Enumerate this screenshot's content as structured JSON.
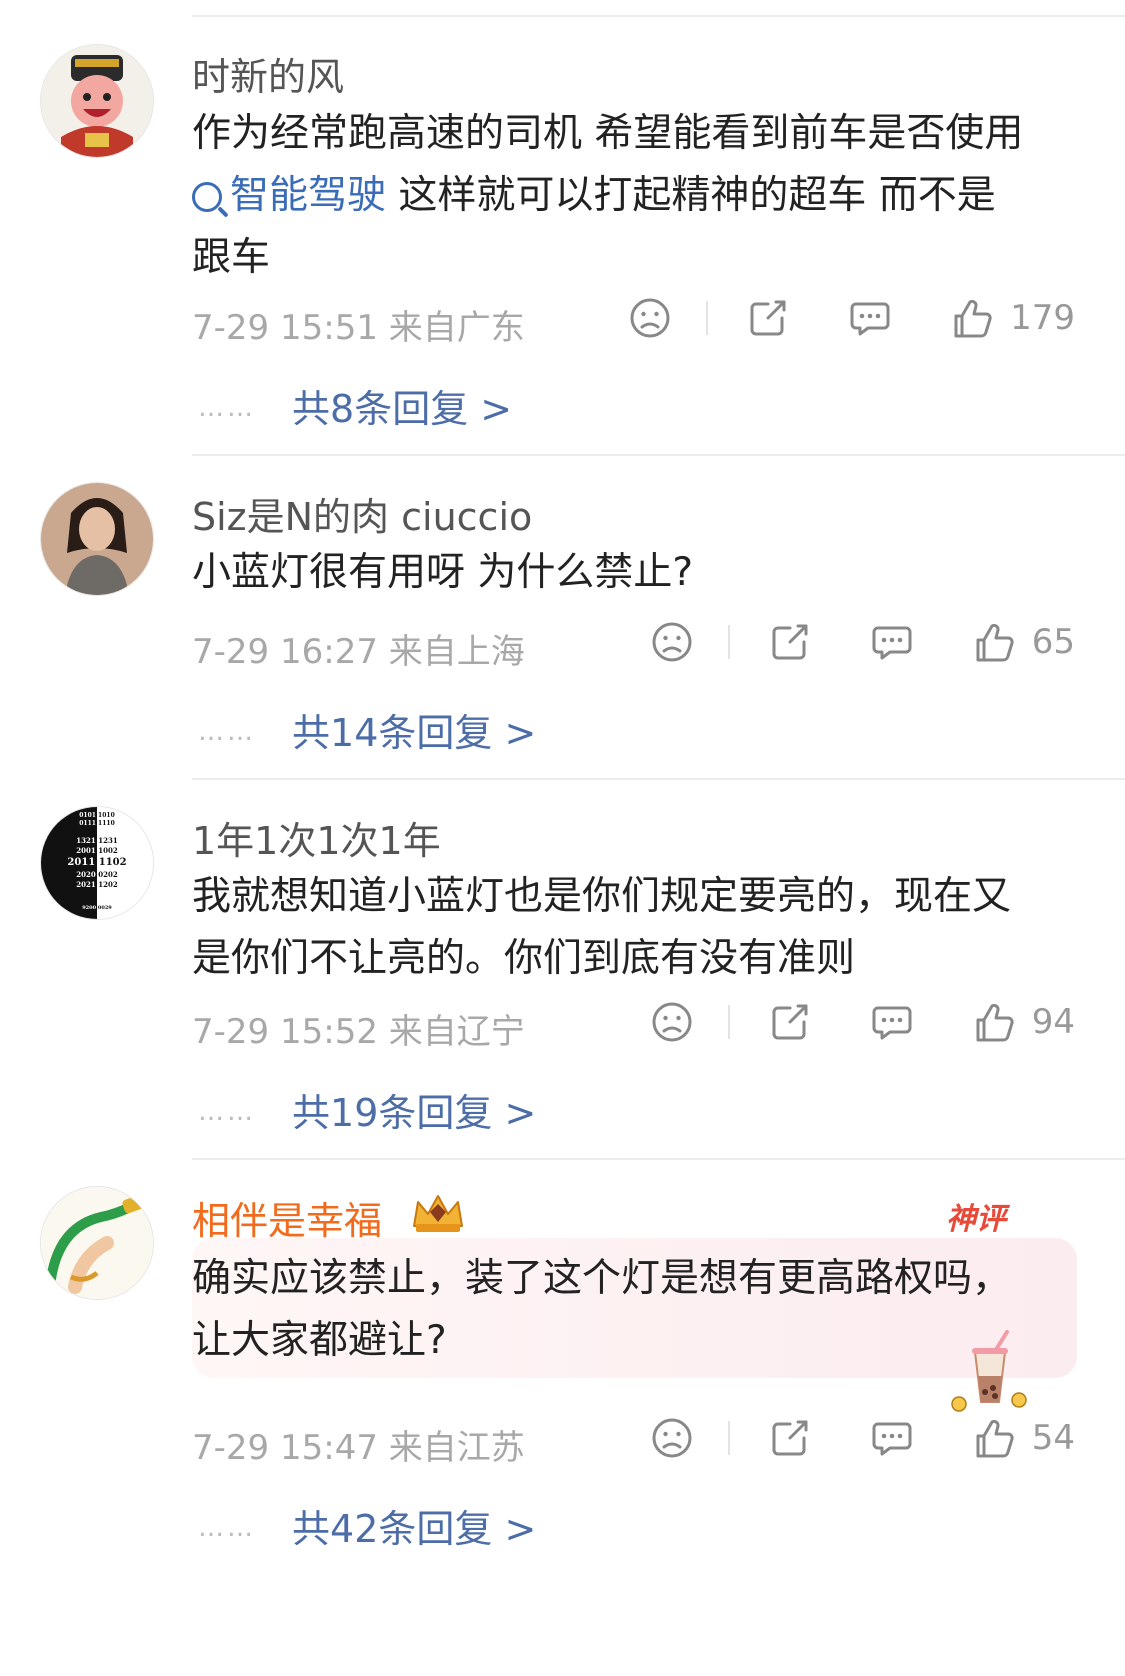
{
  "comments": [
    {
      "username": "时新的风",
      "body_line1": "作为经常跑高速的司机 希望能看到前车是否使用",
      "topic": "智能驾驶",
      "body_line2_rest": " 这样就可以打起精神的超车 而不是",
      "body_line3": "跟车",
      "time": "7-29 15:51",
      "location": "来自广东",
      "likes": "179",
      "replies_prefix": "共",
      "replies_count": "8",
      "replies_suffix": "条回复 >"
    },
    {
      "username": "Siz是N的肉 ciuccio",
      "body": "小蓝灯很有用呀 为什么禁止?",
      "time": "7-29 16:27",
      "location": "来自上海",
      "likes": "65",
      "replies_prefix": "共",
      "replies_count": "14",
      "replies_suffix": "条回复 >"
    },
    {
      "username": "1年1次1次1年",
      "body_line1": "我就想知道小蓝灯也是你们规定要亮的，现在又",
      "body_line2": "是你们不让亮的。你们到底有没有准则",
      "time": "7-29 15:52",
      "location": "来自辽宁",
      "likes": "94",
      "replies_prefix": "共",
      "replies_count": "19",
      "replies_suffix": "条回复 >"
    },
    {
      "username": "相伴是幸福",
      "badge": "神评",
      "body_line1": "确实应该禁止，装了这个灯是想有更高路权吗，",
      "body_line2": "让大家都避让?",
      "time": "7-29 15:47",
      "location": "来自江苏",
      "likes": "54",
      "replies_prefix": "共",
      "replies_count": "42",
      "replies_suffix": "条回复 >"
    }
  ],
  "dots": "……",
  "avatar3_lines": [
    "0101 1010",
    "0111 1110",
    "1321 1231",
    "2001 1002",
    "2011 1102",
    "2020 0202",
    "2021 1202",
    "9200 0029"
  ],
  "colors": {
    "accent": "#4d6da8",
    "topic": "#3b6cb7",
    "vip_name": "#f26a1b",
    "badge": "#e84a3a"
  }
}
